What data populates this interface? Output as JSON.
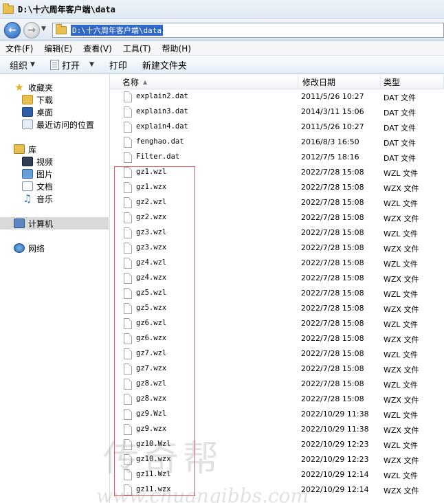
{
  "window": {
    "title": "D:\\十六周年客户端\\data"
  },
  "address": {
    "path": "D:\\十六周年客户端\\data"
  },
  "menu": [
    {
      "label": "文件(F)"
    },
    {
      "label": "编辑(E)"
    },
    {
      "label": "查看(V)"
    },
    {
      "label": "工具(T)"
    },
    {
      "label": "帮助(H)"
    }
  ],
  "toolbar": {
    "organize": "组织",
    "open": "打开",
    "print": "打印",
    "new_folder": "新建文件夹"
  },
  "nav": {
    "favorites": "收藏夹",
    "downloads": "下载",
    "desktop": "桌面",
    "recent": "最近访问的位置",
    "libraries": "库",
    "videos": "视频",
    "pictures": "图片",
    "documents": "文档",
    "music": "音乐",
    "computer": "计算机",
    "network": "网络"
  },
  "columns": {
    "name": "名称",
    "date": "修改日期",
    "type": "类型"
  },
  "files": [
    {
      "name": "explain2.dat",
      "date": "2011/5/26 10:27",
      "type": "DAT 文件"
    },
    {
      "name": "explain3.dat",
      "date": "2014/3/11 15:06",
      "type": "DAT 文件"
    },
    {
      "name": "explain4.dat",
      "date": "2011/5/26 10:27",
      "type": "DAT 文件"
    },
    {
      "name": "fenghao.dat",
      "date": "2016/8/3 16:50",
      "type": "DAT 文件"
    },
    {
      "name": "Filter.dat",
      "date": "2012/7/5 18:16",
      "type": "DAT 文件"
    },
    {
      "name": "gz1.wzl",
      "date": "2022/7/28 15:08",
      "type": "WZL 文件"
    },
    {
      "name": "gz1.wzx",
      "date": "2022/7/28 15:08",
      "type": "WZX 文件"
    },
    {
      "name": "gz2.wzl",
      "date": "2022/7/28 15:08",
      "type": "WZL 文件"
    },
    {
      "name": "gz2.wzx",
      "date": "2022/7/28 15:08",
      "type": "WZX 文件"
    },
    {
      "name": "gz3.wzl",
      "date": "2022/7/28 15:08",
      "type": "WZL 文件"
    },
    {
      "name": "gz3.wzx",
      "date": "2022/7/28 15:08",
      "type": "WZX 文件"
    },
    {
      "name": "gz4.wzl",
      "date": "2022/7/28 15:08",
      "type": "WZL 文件"
    },
    {
      "name": "gz4.wzx",
      "date": "2022/7/28 15:08",
      "type": "WZX 文件"
    },
    {
      "name": "gz5.wzl",
      "date": "2022/7/28 15:08",
      "type": "WZL 文件"
    },
    {
      "name": "gz5.wzx",
      "date": "2022/7/28 15:08",
      "type": "WZX 文件"
    },
    {
      "name": "gz6.wzl",
      "date": "2022/7/28 15:08",
      "type": "WZL 文件"
    },
    {
      "name": "gz6.wzx",
      "date": "2022/7/28 15:08",
      "type": "WZX 文件"
    },
    {
      "name": "gz7.wzl",
      "date": "2022/7/28 15:08",
      "type": "WZL 文件"
    },
    {
      "name": "gz7.wzx",
      "date": "2022/7/28 15:08",
      "type": "WZX 文件"
    },
    {
      "name": "gz8.wzl",
      "date": "2022/7/28 15:08",
      "type": "WZL 文件"
    },
    {
      "name": "gz8.wzx",
      "date": "2022/7/28 15:08",
      "type": "WZX 文件"
    },
    {
      "name": "gz9.Wzl",
      "date": "2022/10/29 11:38",
      "type": "WZL 文件"
    },
    {
      "name": "gz9.wzx",
      "date": "2022/10/29 11:38",
      "type": "WZX 文件"
    },
    {
      "name": "gz10.Wzl",
      "date": "2022/10/29 12:23",
      "type": "WZL 文件"
    },
    {
      "name": "gz10.wzx",
      "date": "2022/10/29 12:23",
      "type": "WZX 文件"
    },
    {
      "name": "gz11.Wzl",
      "date": "2022/10/29 12:14",
      "type": "WZL 文件"
    },
    {
      "name": "gz11.wzx",
      "date": "2022/10/29 12:14",
      "type": "WZX 文件"
    }
  ],
  "watermark": {
    "text": "传奇帮",
    "url": "www.chuanqibbs.com"
  },
  "colors": {
    "selection": "#3168c8",
    "highlight_box": "#e05555",
    "nav_selected": "#d9d9d9"
  }
}
